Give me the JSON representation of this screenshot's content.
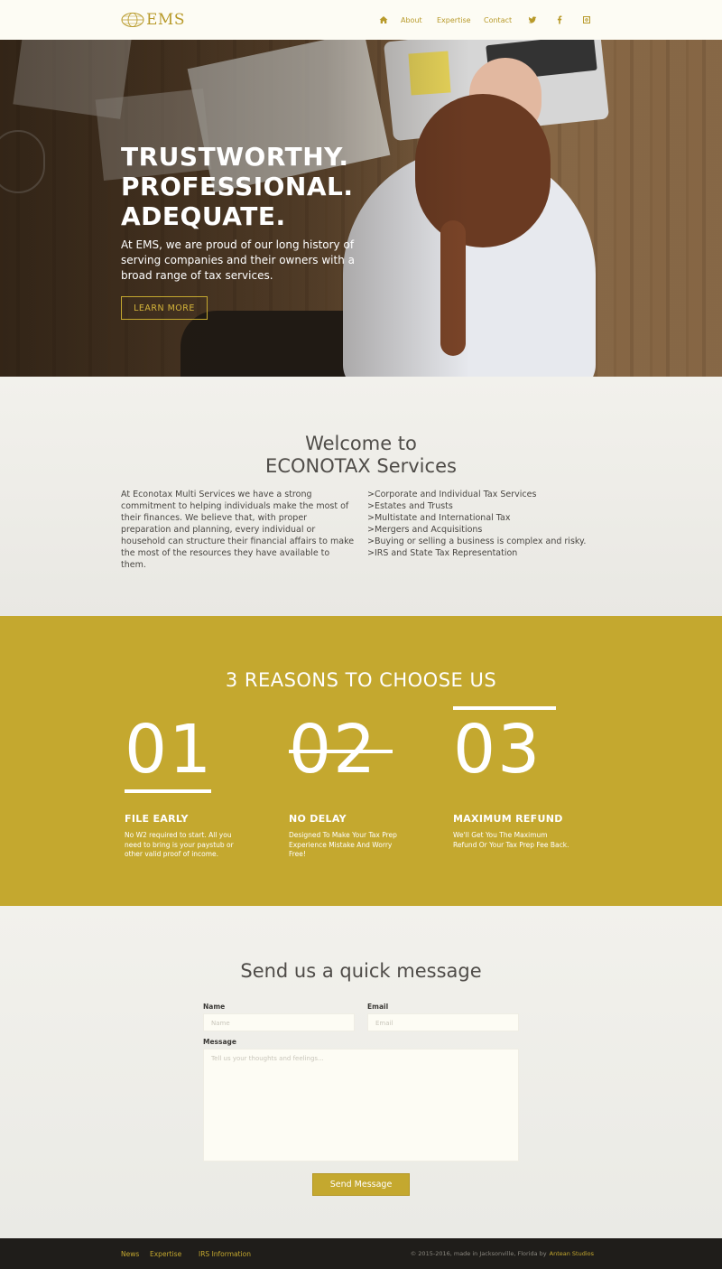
{
  "header": {
    "logo_text": "EMS",
    "nav": {
      "about": "About",
      "expertise": "Expertise",
      "contact": "Contact"
    },
    "icons": [
      "home-icon",
      "twitter-icon",
      "facebook-icon",
      "instagram-icon"
    ]
  },
  "hero": {
    "title": "TRUSTWORTHY.\nPROFESSIONAL.\nADEQUATE.",
    "text": "At EMS, we are proud of our long history of serving companies and their owners with a broad range of tax services.",
    "button": "LEARN MORE"
  },
  "welcome": {
    "title": "Welcome to\nECONOTAX Services",
    "paragraph": "At Econotax Multi Services we have a strong commitment to helping individuals make the most of their finances. We believe that, with proper preparation and planning, every individual or household can structure their financial affairs to make the most of the resources they have available to them.",
    "services": [
      ">Corporate and Individual Tax Services",
      ">Estates and Trusts",
      ">Multistate and International Tax",
      ">Mergers and Acquisitions",
      ">Buying or selling a business is complex and risky.",
      ">IRS and State Tax Representation"
    ]
  },
  "reasons": {
    "title": "3 REASONS TO CHOOSE US",
    "items": [
      {
        "number": "01",
        "heading": "FILE EARLY",
        "text": "No W2 required to start. All you need to bring is your paystub or other valid proof of income."
      },
      {
        "number": "02",
        "heading": "NO DELAY",
        "text": "Designed To Make Your Tax Prep Experience Mistake And Worry Free!"
      },
      {
        "number": "03",
        "heading": "MAXIMUM REFUND",
        "text": "We'll Get You The Maximum Refund Or Your Tax Prep Fee Back."
      }
    ]
  },
  "contact": {
    "title": "Send us a quick message",
    "name_label": "Name",
    "name_placeholder": "Name",
    "email_label": "Email",
    "email_placeholder": "Email",
    "message_label": "Message",
    "message_placeholder": "Tell us your thoughts and feelings...",
    "send_button": "Send Message"
  },
  "footer": {
    "links": [
      "News",
      "Expertise",
      "IRS Information"
    ],
    "copyright": "© 2015-2016, made in Jacksonville, Florida by",
    "studio": "Antean Studios"
  },
  "colors": {
    "accent": "#c4a82f",
    "header_bg": "#fdfcf4",
    "footer_bg": "#1f1d1a",
    "text": "#4a4743"
  }
}
